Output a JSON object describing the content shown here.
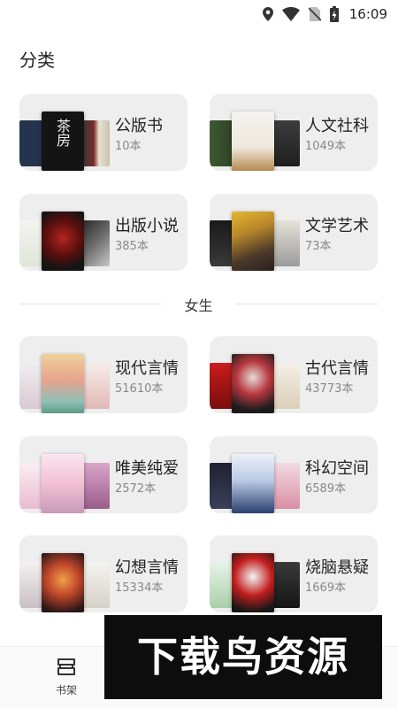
{
  "status_bar": {
    "time": "16:09",
    "icons": [
      "location-icon",
      "wifi-icon",
      "no-sim-icon",
      "battery-charging-icon"
    ]
  },
  "page": {
    "section_title": "分类"
  },
  "categories": [
    {
      "name": "公版书",
      "count": "10本"
    },
    {
      "name": "人文社科",
      "count": "1049本"
    },
    {
      "name": "出版小说",
      "count": "385本"
    },
    {
      "name": "文学艺术",
      "count": "73本"
    }
  ],
  "female": {
    "divider_label": "女生",
    "categories": [
      {
        "name": "现代言情",
        "count": "51610本"
      },
      {
        "name": "古代言情",
        "count": "43773本"
      },
      {
        "name": "唯美纯爱",
        "count": "2572本"
      },
      {
        "name": "科幻空间",
        "count": "6589本"
      },
      {
        "name": "幻想言情",
        "count": "15334本"
      },
      {
        "name": "烧脑悬疑",
        "count": "1669本"
      }
    ]
  },
  "bottom_nav": {
    "bookshelf_label": "书架"
  },
  "watermark": {
    "text": "下载鸟资源"
  },
  "colors": {
    "card_bg": "#eeeeee",
    "count_text": "#888888",
    "watermark_bg": "#0d0d0d"
  }
}
